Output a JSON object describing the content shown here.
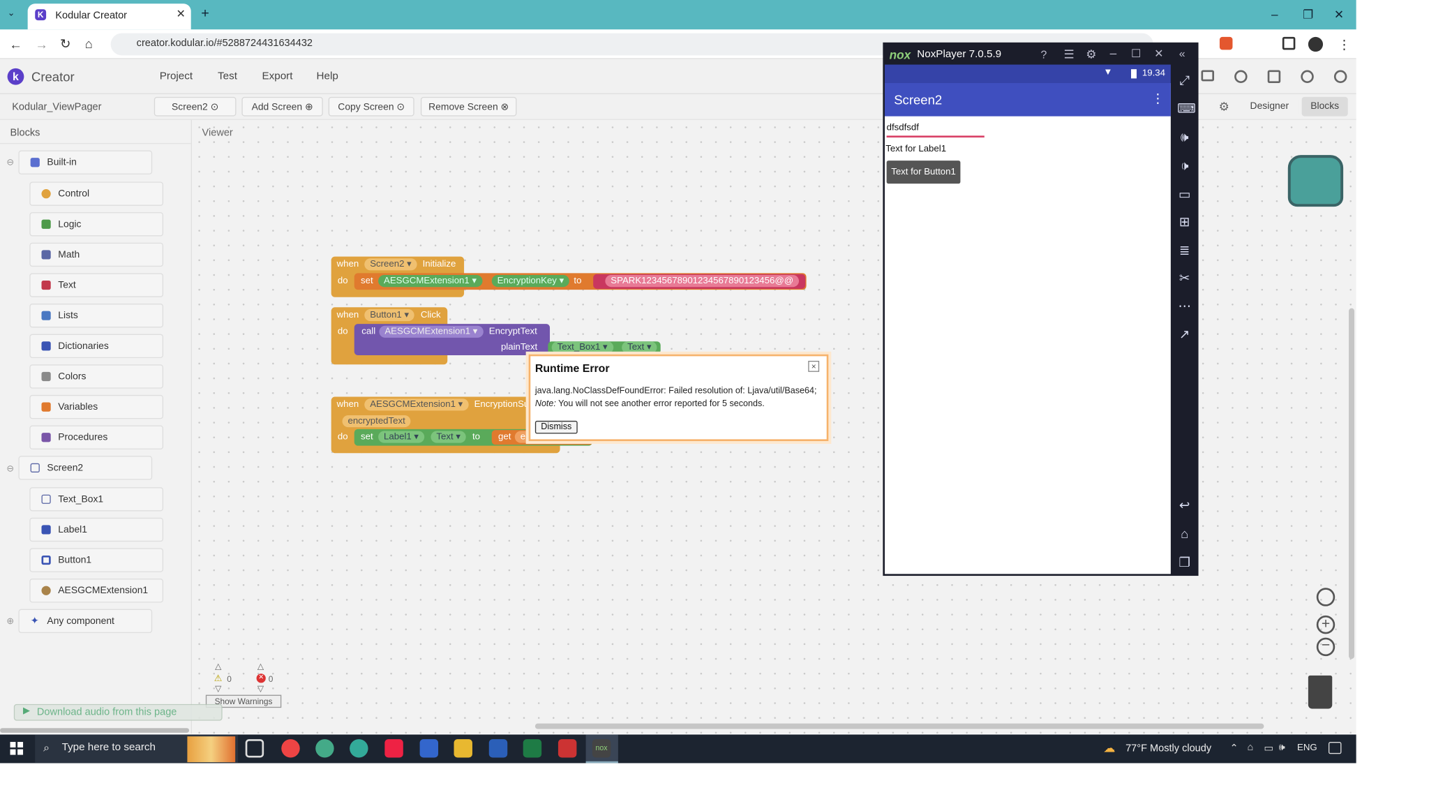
{
  "browser": {
    "tab_title": "Kodular Creator",
    "url": "creator.kodular.io/#5288724431634432",
    "new_tab": "+"
  },
  "app": {
    "logo_text": "Creator",
    "menu": [
      "Project",
      "Test",
      "Export",
      "Help"
    ],
    "project_name": "Kodular_ViewPager",
    "screen_bar": {
      "screen": "Screen2",
      "add": "Add Screen",
      "copy": "Copy Screen",
      "remove": "Remove Screen"
    },
    "mode": {
      "designer": "Designer",
      "blocks": "Blocks"
    }
  },
  "sidebar": {
    "header": "Blocks",
    "builtin": "Built-in",
    "builtin_items": [
      "Control",
      "Logic",
      "Math",
      "Text",
      "Lists",
      "Dictionaries",
      "Colors",
      "Variables",
      "Procedures"
    ],
    "screen": "Screen2",
    "components": [
      "Text_Box1",
      "Label1",
      "Button1",
      "AESGCMExtension1"
    ],
    "any": "Any component"
  },
  "viewer": {
    "header": "Viewer",
    "block1": {
      "when": "when",
      "component": "Screen2",
      "event": "Initialize",
      "do": "do",
      "set": "set",
      "target": "AESGCMExtension1",
      "prop": "EncryptionKey",
      "to": "to",
      "value": "SPARK12345678901234567890123456@@"
    },
    "block2": {
      "when": "when",
      "component": "Button1",
      "event": "Click",
      "do": "do",
      "call": "call",
      "target": "AESGCMExtension1",
      "method": "EncryptText",
      "param": "plainText",
      "arg_comp": "Text_Box1",
      "arg_prop": "Text"
    },
    "block3": {
      "when": "when",
      "component": "AESGCMExtension1",
      "event": "EncryptionSu",
      "param": "encryptedText",
      "do": "do",
      "set": "set",
      "target": "Label1",
      "prop": "Text",
      "to": "to",
      "get": "get",
      "get_var": "en"
    },
    "warnings": {
      "count": "0",
      "errors": "0",
      "button": "Show Warnings"
    }
  },
  "dialog": {
    "title": "Runtime Error",
    "message": "java.lang.NoClassDefFoundError: Failed resolution of: Ljava/util/Base64;",
    "note_label": "Note:",
    "note": " You will not see another error reported for 5 seconds.",
    "dismiss": "Dismiss",
    "close": "×"
  },
  "nox": {
    "title": "NoxPlayer 7.0.5.9",
    "logo": "nox",
    "time": "19.34",
    "app_title": "Screen2",
    "textbox_value": "dfsdfsdf",
    "label": "Text for Label1",
    "button": "Text for Button1"
  },
  "extension_bar": {
    "text": "Download audio from this page"
  },
  "taskbar": {
    "search": "Type here to search",
    "weather": "77°F  Mostly cloudy",
    "lang": "ENG"
  }
}
